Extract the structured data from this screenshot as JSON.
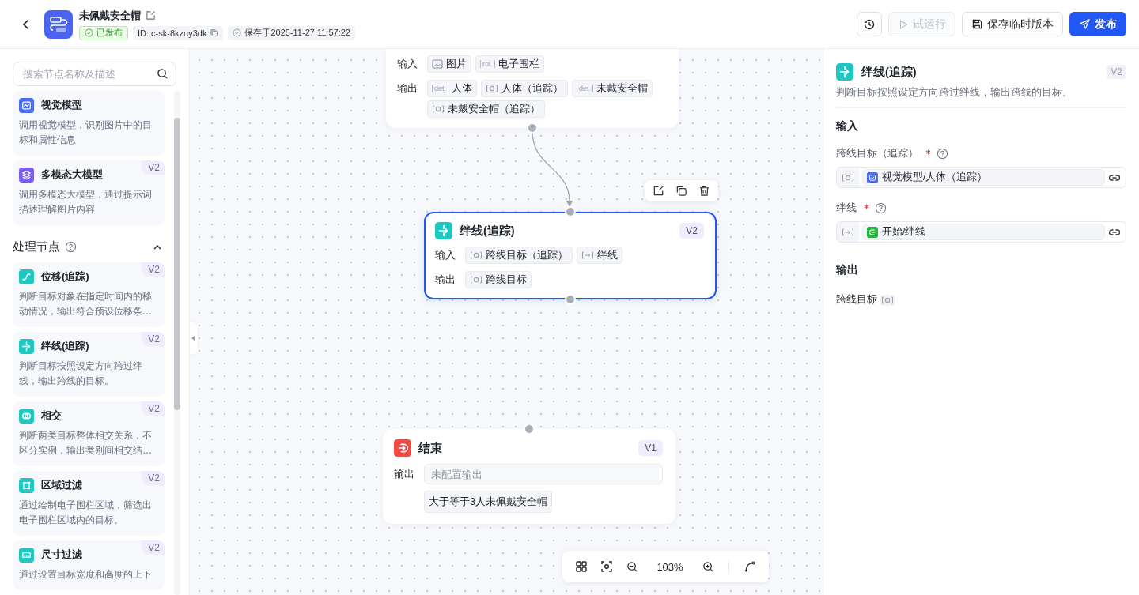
{
  "header": {
    "title": "未佩戴安全帽",
    "status": "已发布",
    "id_label": "ID: c-sk-8kzuy3dk",
    "saved_label": "保存于2025-11-27 11:57:22",
    "buttons": [
      {
        "kind": "history",
        "disabled": false
      },
      {
        "kind": "run",
        "label": "试运行",
        "disabled": true
      },
      {
        "kind": "save",
        "label": "保存临时版本",
        "disabled": false
      },
      {
        "kind": "publish",
        "label": "发布",
        "disabled": false
      }
    ]
  },
  "sidebar": {
    "search": {
      "placeholder": "搜索节点名称及描述"
    },
    "groups": [
      {
        "items": [
          {
            "title": "视觉模型",
            "description": "调用视觉模型，识别图片中的目标和属性信息"
          },
          {
            "title": "多模态大模型",
            "description": "调用多模态大模型，通过提示词描述理解图片内容",
            "version": "V2"
          }
        ]
      },
      {
        "title": "处理节点",
        "expanded": true,
        "items": [
          {
            "title": "位移(追踪)",
            "description": "判断目标对象在指定时间内的移动情况，输出符合预设位移条…",
            "version": "V2"
          },
          {
            "title": "绊线(追踪)",
            "description": "判断目标按照设定方向跨过绊线，输出跨线的目标。",
            "version": "V2"
          },
          {
            "title": "相交",
            "description": "判断两类目标整体相交关系，不区分实例，输出类别间相交结…",
            "version": "V2"
          },
          {
            "title": "区域过滤",
            "description": "通过绘制电子围栏区域，筛选出电子围栏区域内的目标。",
            "version": "V2"
          },
          {
            "title": "尺寸过滤",
            "description": "通过设置目标宽度和高度的上下",
            "version": "V2"
          }
        ]
      }
    ]
  },
  "canvas": {
    "nodes": [
      {
        "kind": "source",
        "selected": false,
        "input_label": "输入",
        "inputs": [
          {
            "kind": "image",
            "label": "图片"
          },
          {
            "kind": "tag",
            "tag": "roi.",
            "label": "电子围栏"
          }
        ],
        "output_label": "输出",
        "outputs": [
          {
            "kind": "tag",
            "tag": "det.",
            "label": "人体"
          },
          {
            "kind": "track",
            "label": "人体（追踪）"
          },
          {
            "kind": "tag",
            "tag": "det.",
            "label": "未戴安全帽"
          },
          {
            "kind": "track",
            "label": "未戴安全帽（追踪）"
          }
        ]
      },
      {
        "kind": "process",
        "title": "绊线(追踪)",
        "version": "V2",
        "selected": true,
        "input_label": "输入",
        "inputs": [
          {
            "kind": "track",
            "label": "跨线目标（追踪）"
          },
          {
            "kind": "line",
            "label": "绊线"
          }
        ],
        "output_label": "输出",
        "outputs": [
          {
            "kind": "track",
            "label": "跨线目标"
          }
        ]
      },
      {
        "kind": "end",
        "title": "结束",
        "version": "V1",
        "selected": false,
        "output_label": "输出",
        "output": {
          "placeholder": "未配置输出"
        },
        "values": [
          "大于等于3人未佩戴安全帽"
        ]
      }
    ],
    "zoom": "103%"
  },
  "panel": {
    "title": "绊线(追踪)",
    "version": "V2",
    "description": "判断目标按照设定方向跨过绊线，输出跨线的目标。",
    "input_heading": "输入",
    "fields": [
      {
        "label": "跨线目标（追踪）",
        "required": true,
        "kind": "track",
        "value": "视觉模型/人体（追踪）"
      },
      {
        "label": "绊线",
        "required": true,
        "kind": "line",
        "value": "开始/绊线"
      }
    ],
    "output_heading": "输出",
    "outputs": [
      {
        "label": "跨线目标",
        "kind": "track"
      }
    ]
  }
}
